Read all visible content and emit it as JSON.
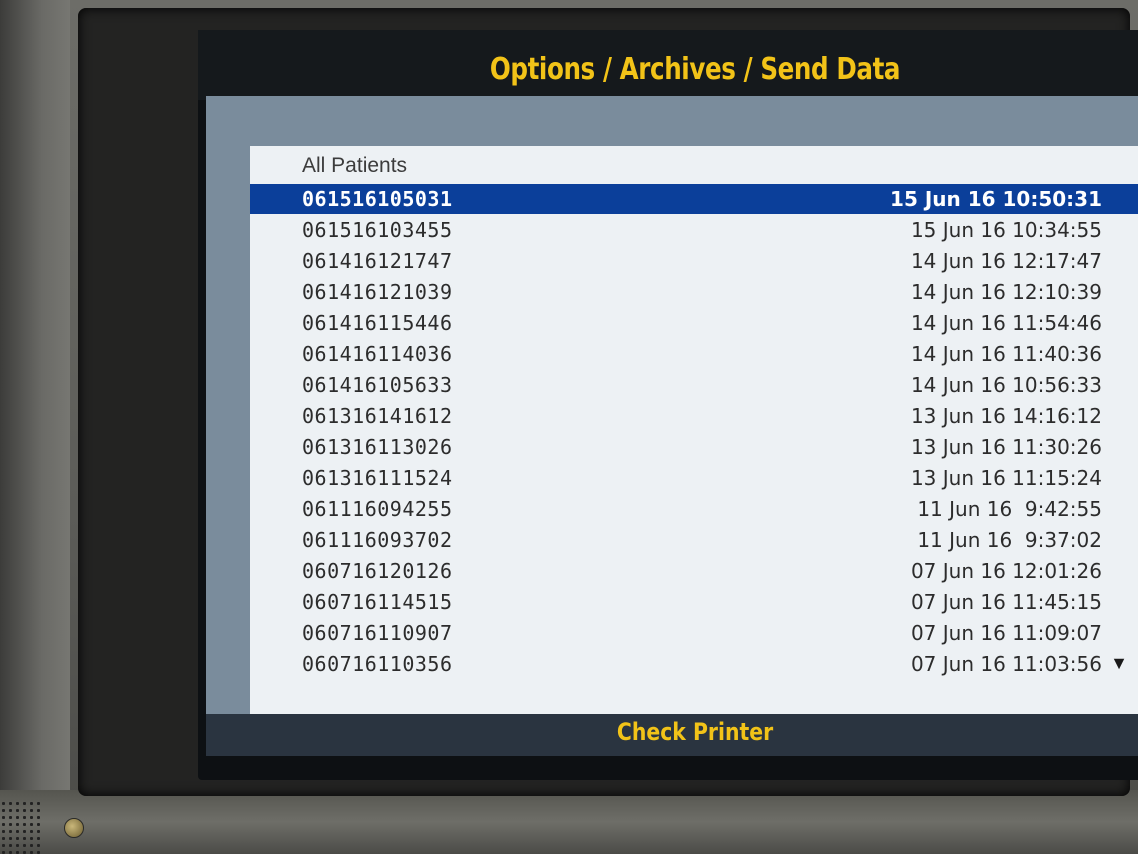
{
  "title": "Options / Archives / Send Data",
  "list": {
    "header": "All Patients",
    "selected_index": 0,
    "rows": [
      {
        "id": "061516105031",
        "time": "15 Jun 16 10:50:31"
      },
      {
        "id": "061516103455",
        "time": "15 Jun 16 10:34:55"
      },
      {
        "id": "061416121747",
        "time": "14 Jun 16 12:17:47"
      },
      {
        "id": "061416121039",
        "time": "14 Jun 16 12:10:39"
      },
      {
        "id": "061416115446",
        "time": "14 Jun 16 11:54:46"
      },
      {
        "id": "061416114036",
        "time": "14 Jun 16 11:40:36"
      },
      {
        "id": "061416105633",
        "time": "14 Jun 16 10:56:33"
      },
      {
        "id": "061316141612",
        "time": "13 Jun 16 14:16:12"
      },
      {
        "id": "061316113026",
        "time": "13 Jun 16 11:30:26"
      },
      {
        "id": "061316111524",
        "time": "13 Jun 16 11:15:24"
      },
      {
        "id": "061116094255",
        "time": "11 Jun 16  9:42:55"
      },
      {
        "id": "061116093702",
        "time": "11 Jun 16  9:37:02"
      },
      {
        "id": "060716120126",
        "time": "07 Jun 16 12:01:26"
      },
      {
        "id": "060716114515",
        "time": "07 Jun 16 11:45:15"
      },
      {
        "id": "060716110907",
        "time": "07 Jun 16 11:09:07"
      },
      {
        "id": "060716110356",
        "time": "07 Jun 16 11:03:56"
      }
    ],
    "scroll_icon": "triangle-down-icon",
    "scroll_glyph": "▼"
  },
  "footer": "Check Printer",
  "colors": {
    "title_text": "#f2c318",
    "selection": "#0b3f9a",
    "list_background": "#edf1f4"
  }
}
